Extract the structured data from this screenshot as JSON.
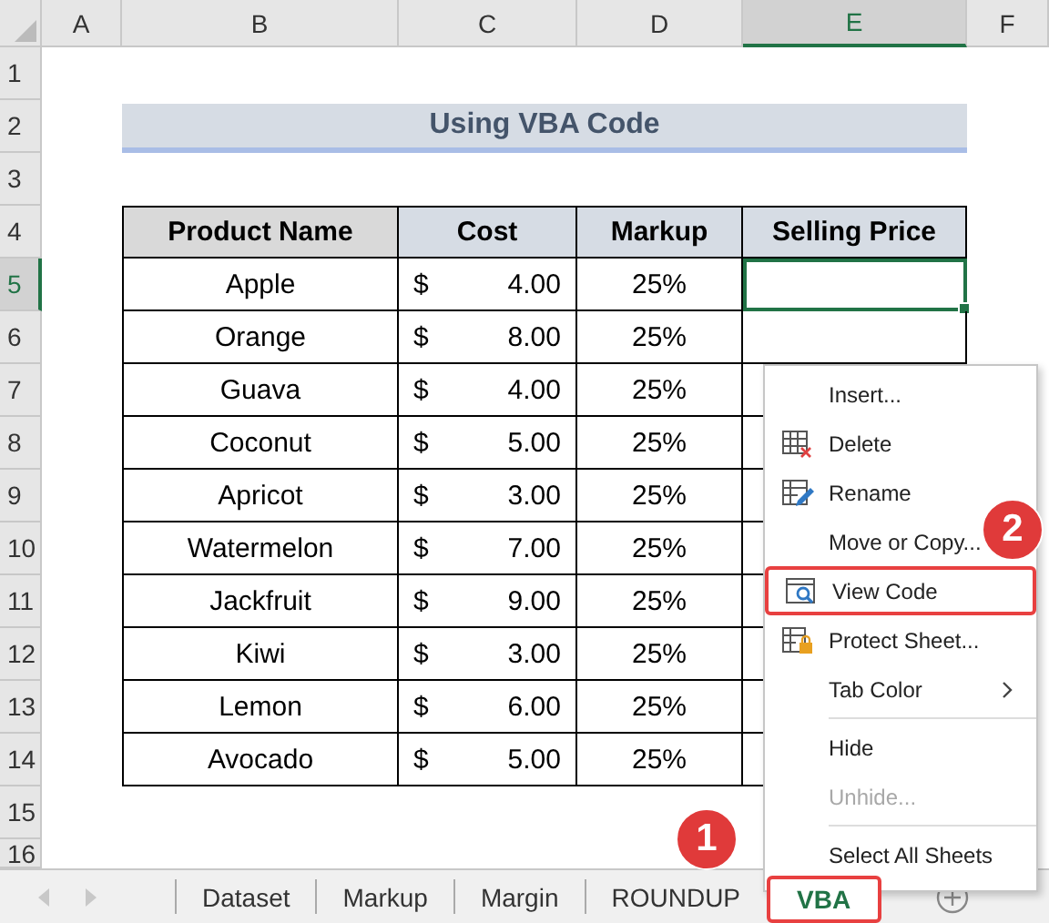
{
  "columns": [
    {
      "label": "A",
      "selected": false
    },
    {
      "label": "B",
      "selected": false
    },
    {
      "label": "C",
      "selected": false
    },
    {
      "label": "D",
      "selected": false
    },
    {
      "label": "E",
      "selected": true
    },
    {
      "label": "F",
      "selected": false
    }
  ],
  "rows": [
    {
      "label": "1",
      "selected": false
    },
    {
      "label": "2",
      "selected": false
    },
    {
      "label": "3",
      "selected": false
    },
    {
      "label": "4",
      "selected": false
    },
    {
      "label": "5",
      "selected": true
    },
    {
      "label": "6",
      "selected": false
    },
    {
      "label": "7",
      "selected": false
    },
    {
      "label": "8",
      "selected": false
    },
    {
      "label": "9",
      "selected": false
    },
    {
      "label": "10",
      "selected": false
    },
    {
      "label": "11",
      "selected": false
    },
    {
      "label": "12",
      "selected": false
    },
    {
      "label": "13",
      "selected": false
    },
    {
      "label": "14",
      "selected": false
    },
    {
      "label": "15",
      "selected": false
    },
    {
      "label": "16",
      "selected": false
    }
  ],
  "title": "Using VBA Code",
  "table": {
    "columns": [
      "Product Name",
      "Cost",
      "Markup",
      "Selling Price"
    ],
    "rows": [
      {
        "product": "Apple",
        "currency": "$",
        "cost": "4.00",
        "markup": "25%",
        "selected": true
      },
      {
        "product": "Orange",
        "currency": "$",
        "cost": "8.00",
        "markup": "25%",
        "selected": false
      },
      {
        "product": "Guava",
        "currency": "$",
        "cost": "4.00",
        "markup": "25%",
        "selected": false
      },
      {
        "product": "Coconut",
        "currency": "$",
        "cost": "5.00",
        "markup": "25%",
        "selected": false
      },
      {
        "product": "Apricot",
        "currency": "$",
        "cost": "3.00",
        "markup": "25%",
        "selected": false
      },
      {
        "product": "Watermelon",
        "currency": "$",
        "cost": "7.00",
        "markup": "25%",
        "selected": false
      },
      {
        "product": "Jackfruit",
        "currency": "$",
        "cost": "9.00",
        "markup": "25%",
        "selected": false
      },
      {
        "product": "Kiwi",
        "currency": "$",
        "cost": "3.00",
        "markup": "25%",
        "selected": false
      },
      {
        "product": "Lemon",
        "currency": "$",
        "cost": "6.00",
        "markup": "25%",
        "selected": false
      },
      {
        "product": "Avocado",
        "currency": "$",
        "cost": "5.00",
        "markup": "25%",
        "selected": false
      }
    ]
  },
  "context_menu": [
    {
      "kind": "item",
      "label": "Insert...",
      "disabled": false,
      "highlighted": false,
      "submenu": false
    },
    {
      "kind": "item",
      "label": "Delete",
      "disabled": false,
      "highlighted": false,
      "submenu": false
    },
    {
      "kind": "item",
      "label": "Rename",
      "disabled": false,
      "highlighted": false,
      "submenu": false
    },
    {
      "kind": "item",
      "label": "Move or Copy...",
      "disabled": false,
      "highlighted": false,
      "submenu": false
    },
    {
      "kind": "item",
      "label": "View Code",
      "disabled": false,
      "highlighted": true,
      "submenu": false
    },
    {
      "kind": "item",
      "label": "Protect Sheet...",
      "disabled": false,
      "highlighted": false,
      "submenu": false
    },
    {
      "kind": "item",
      "label": "Tab Color",
      "disabled": false,
      "highlighted": false,
      "submenu": true
    },
    {
      "kind": "separator"
    },
    {
      "kind": "item",
      "label": "Hide",
      "disabled": false,
      "highlighted": false,
      "submenu": false
    },
    {
      "kind": "item",
      "label": "Unhide...",
      "disabled": true,
      "highlighted": false,
      "submenu": false
    },
    {
      "kind": "separator"
    },
    {
      "kind": "item",
      "label": "Select All Sheets",
      "disabled": false,
      "highlighted": false,
      "submenu": false
    }
  ],
  "sheet_tabs": [
    {
      "label": "Dataset",
      "selected": false
    },
    {
      "label": "Markup",
      "selected": false
    },
    {
      "label": "Margin",
      "selected": false
    },
    {
      "label": "ROUNDUP",
      "selected": false
    },
    {
      "label": "VBA",
      "selected": true
    }
  ],
  "callouts": [
    "1",
    "2"
  ]
}
